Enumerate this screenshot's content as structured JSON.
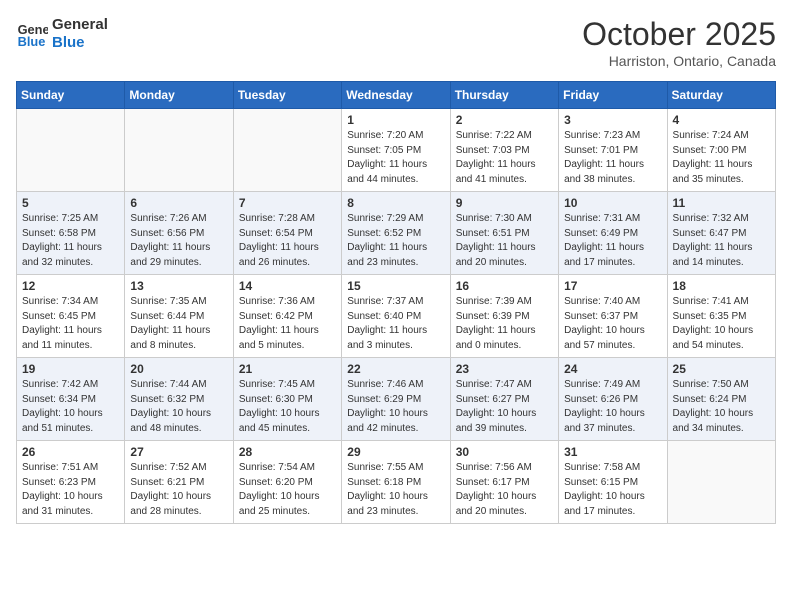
{
  "logo": {
    "line1": "General",
    "line2": "Blue"
  },
  "title": "October 2025",
  "subtitle": "Harriston, Ontario, Canada",
  "days_of_week": [
    "Sunday",
    "Monday",
    "Tuesday",
    "Wednesday",
    "Thursday",
    "Friday",
    "Saturday"
  ],
  "weeks": [
    [
      {
        "day": "",
        "info": ""
      },
      {
        "day": "",
        "info": ""
      },
      {
        "day": "",
        "info": ""
      },
      {
        "day": "1",
        "info": "Sunrise: 7:20 AM\nSunset: 7:05 PM\nDaylight: 11 hours and 44 minutes."
      },
      {
        "day": "2",
        "info": "Sunrise: 7:22 AM\nSunset: 7:03 PM\nDaylight: 11 hours and 41 minutes."
      },
      {
        "day": "3",
        "info": "Sunrise: 7:23 AM\nSunset: 7:01 PM\nDaylight: 11 hours and 38 minutes."
      },
      {
        "day": "4",
        "info": "Sunrise: 7:24 AM\nSunset: 7:00 PM\nDaylight: 11 hours and 35 minutes."
      }
    ],
    [
      {
        "day": "5",
        "info": "Sunrise: 7:25 AM\nSunset: 6:58 PM\nDaylight: 11 hours and 32 minutes."
      },
      {
        "day": "6",
        "info": "Sunrise: 7:26 AM\nSunset: 6:56 PM\nDaylight: 11 hours and 29 minutes."
      },
      {
        "day": "7",
        "info": "Sunrise: 7:28 AM\nSunset: 6:54 PM\nDaylight: 11 hours and 26 minutes."
      },
      {
        "day": "8",
        "info": "Sunrise: 7:29 AM\nSunset: 6:52 PM\nDaylight: 11 hours and 23 minutes."
      },
      {
        "day": "9",
        "info": "Sunrise: 7:30 AM\nSunset: 6:51 PM\nDaylight: 11 hours and 20 minutes."
      },
      {
        "day": "10",
        "info": "Sunrise: 7:31 AM\nSunset: 6:49 PM\nDaylight: 11 hours and 17 minutes."
      },
      {
        "day": "11",
        "info": "Sunrise: 7:32 AM\nSunset: 6:47 PM\nDaylight: 11 hours and 14 minutes."
      }
    ],
    [
      {
        "day": "12",
        "info": "Sunrise: 7:34 AM\nSunset: 6:45 PM\nDaylight: 11 hours and 11 minutes."
      },
      {
        "day": "13",
        "info": "Sunrise: 7:35 AM\nSunset: 6:44 PM\nDaylight: 11 hours and 8 minutes."
      },
      {
        "day": "14",
        "info": "Sunrise: 7:36 AM\nSunset: 6:42 PM\nDaylight: 11 hours and 5 minutes."
      },
      {
        "day": "15",
        "info": "Sunrise: 7:37 AM\nSunset: 6:40 PM\nDaylight: 11 hours and 3 minutes."
      },
      {
        "day": "16",
        "info": "Sunrise: 7:39 AM\nSunset: 6:39 PM\nDaylight: 11 hours and 0 minutes."
      },
      {
        "day": "17",
        "info": "Sunrise: 7:40 AM\nSunset: 6:37 PM\nDaylight: 10 hours and 57 minutes."
      },
      {
        "day": "18",
        "info": "Sunrise: 7:41 AM\nSunset: 6:35 PM\nDaylight: 10 hours and 54 minutes."
      }
    ],
    [
      {
        "day": "19",
        "info": "Sunrise: 7:42 AM\nSunset: 6:34 PM\nDaylight: 10 hours and 51 minutes."
      },
      {
        "day": "20",
        "info": "Sunrise: 7:44 AM\nSunset: 6:32 PM\nDaylight: 10 hours and 48 minutes."
      },
      {
        "day": "21",
        "info": "Sunrise: 7:45 AM\nSunset: 6:30 PM\nDaylight: 10 hours and 45 minutes."
      },
      {
        "day": "22",
        "info": "Sunrise: 7:46 AM\nSunset: 6:29 PM\nDaylight: 10 hours and 42 minutes."
      },
      {
        "day": "23",
        "info": "Sunrise: 7:47 AM\nSunset: 6:27 PM\nDaylight: 10 hours and 39 minutes."
      },
      {
        "day": "24",
        "info": "Sunrise: 7:49 AM\nSunset: 6:26 PM\nDaylight: 10 hours and 37 minutes."
      },
      {
        "day": "25",
        "info": "Sunrise: 7:50 AM\nSunset: 6:24 PM\nDaylight: 10 hours and 34 minutes."
      }
    ],
    [
      {
        "day": "26",
        "info": "Sunrise: 7:51 AM\nSunset: 6:23 PM\nDaylight: 10 hours and 31 minutes."
      },
      {
        "day": "27",
        "info": "Sunrise: 7:52 AM\nSunset: 6:21 PM\nDaylight: 10 hours and 28 minutes."
      },
      {
        "day": "28",
        "info": "Sunrise: 7:54 AM\nSunset: 6:20 PM\nDaylight: 10 hours and 25 minutes."
      },
      {
        "day": "29",
        "info": "Sunrise: 7:55 AM\nSunset: 6:18 PM\nDaylight: 10 hours and 23 minutes."
      },
      {
        "day": "30",
        "info": "Sunrise: 7:56 AM\nSunset: 6:17 PM\nDaylight: 10 hours and 20 minutes."
      },
      {
        "day": "31",
        "info": "Sunrise: 7:58 AM\nSunset: 6:15 PM\nDaylight: 10 hours and 17 minutes."
      },
      {
        "day": "",
        "info": ""
      }
    ]
  ]
}
